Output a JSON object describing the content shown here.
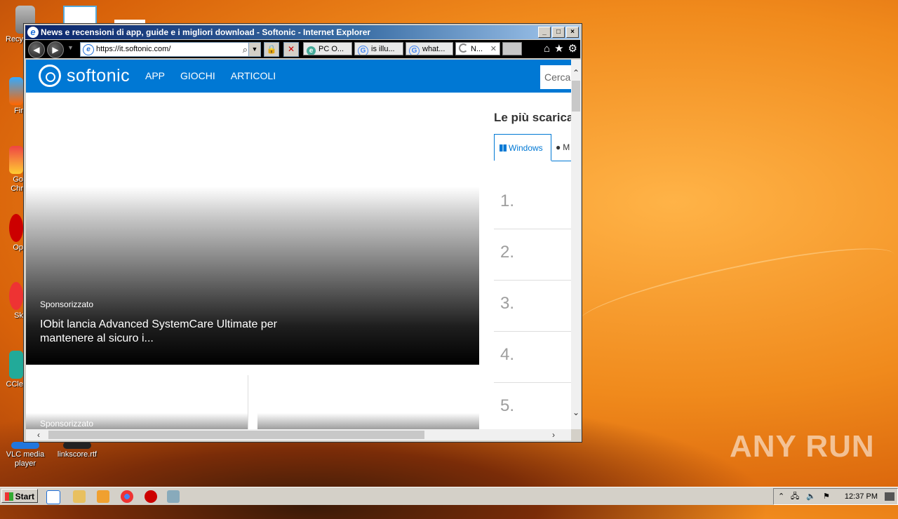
{
  "desktop": {
    "icons": [
      {
        "label": "Recy"
      },
      {
        "label": "Fir"
      },
      {
        "label": "Go Chr"
      },
      {
        "label": "Op"
      },
      {
        "label": "Sk"
      },
      {
        "label": "CCle"
      },
      {
        "label": "VLC media player"
      },
      {
        "label": "linkscore.rtf"
      }
    ],
    "watermark": "ANY RUN"
  },
  "browser": {
    "title": "News e recensioni di app, guide e i migliori download - Softonic - Internet Explorer",
    "window_buttons": {
      "minimize": "_",
      "maximize": "□",
      "close": "×"
    },
    "address": {
      "url": "https://it.softonic.com/"
    },
    "tabs": [
      {
        "label": "PC O...",
        "icon": "ie-page-icon"
      },
      {
        "label": "is illu...",
        "icon": "google-icon"
      },
      {
        "label": "what...",
        "icon": "google-icon"
      },
      {
        "label": "N...",
        "icon": "loading-icon"
      }
    ],
    "toolbar_icons": [
      "home-icon",
      "favorites-star-icon",
      "gear-icon"
    ]
  },
  "page": {
    "logo": "softonic",
    "nav": [
      "APP",
      "GIOCHI",
      "ARTICOLI"
    ],
    "search_placeholder": "Cerca",
    "hero": {
      "tag": "Sponsorizzato",
      "title": "IObit lancia Advanced SystemCare Ultimate per mantenere al sicuro i..."
    },
    "card": {
      "tag": "Sponsorizzato"
    },
    "sidebar": {
      "heading": "Le più scarica",
      "tabs": [
        "Windows",
        "M"
      ],
      "ranks": [
        "1.",
        "2.",
        "3.",
        "4.",
        "5."
      ]
    }
  },
  "taskbar": {
    "start": "Start",
    "clock": "12:37 PM"
  }
}
